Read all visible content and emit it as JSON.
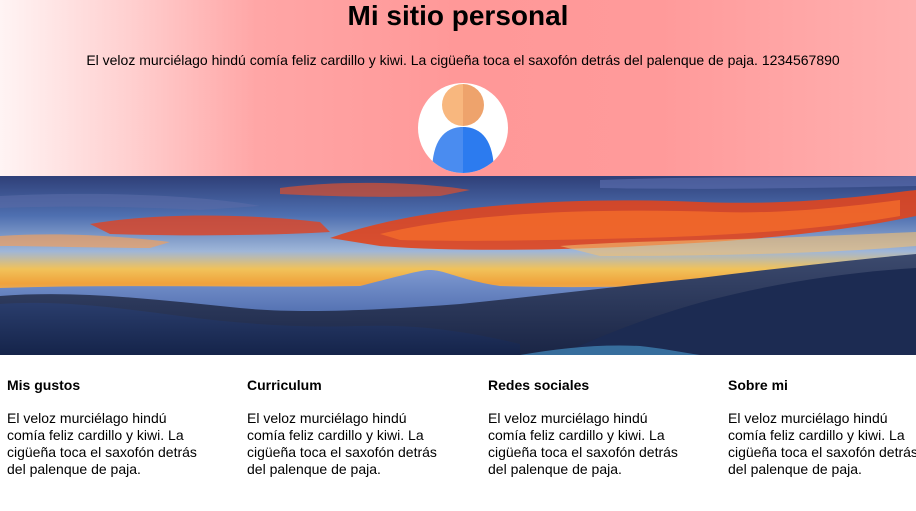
{
  "header": {
    "title": "Mi sitio personal",
    "tagline": "El veloz murciélago hindú comía feliz cardillo y kiwi. La cigüeña toca el saxofón detrás del palenque de paja. 1234567890",
    "avatar_icon": "user-avatar-icon",
    "background_colors": [
      "#fff4f4",
      "#ffa6a6",
      "#ff9898",
      "#ffb0b0"
    ]
  },
  "hero": {
    "description_icon": "mountain-sunset-landscape-image"
  },
  "sections": [
    {
      "title": "Mis gustos",
      "text": "El veloz murciélago hindú comía feliz cardillo y kiwi. La cigüeña toca el saxofón detrás del palenque de paja."
    },
    {
      "title": "Curriculum",
      "text": "El veloz murciélago hindú comía feliz cardillo y kiwi. La cigüeña toca el saxofón detrás del palenque de paja."
    },
    {
      "title": "Redes sociales",
      "text": "El veloz murciélago hindú comía feliz cardillo y kiwi. La cigüeña toca el saxofón detrás del palenque de paja."
    },
    {
      "title": "Sobre mi",
      "text": "El veloz murciélago hindú comía feliz cardillo y kiwi. La cigüeña toca el saxofón detrás del palenque de paja."
    }
  ]
}
